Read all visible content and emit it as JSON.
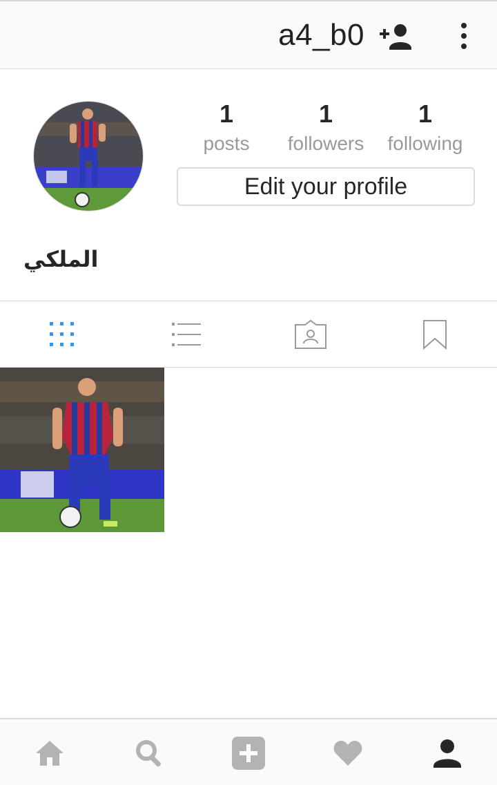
{
  "header": {
    "username": "a4_b0",
    "add_user_icon": "add-person-icon",
    "more_icon": "vertical-dots-icon"
  },
  "profile": {
    "stats": [
      {
        "value": "1",
        "label": "posts"
      },
      {
        "value": "1",
        "label": "followers"
      },
      {
        "value": "1",
        "label": "following"
      }
    ],
    "edit_button_label": "Edit your profile",
    "display_name": "الملكي"
  },
  "tabs": [
    {
      "name": "grid-view",
      "icon": "grid-icon",
      "active": true
    },
    {
      "name": "list-view",
      "icon": "list-icon",
      "active": false
    },
    {
      "name": "tagged",
      "icon": "tagged-photo-icon",
      "active": false
    },
    {
      "name": "saved",
      "icon": "bookmark-icon",
      "active": false
    }
  ],
  "posts": [
    {
      "kind": "photo",
      "subject": "football player in blue and red kit with ball"
    }
  ],
  "bottom_nav": [
    {
      "name": "home",
      "icon": "home-icon",
      "active": false
    },
    {
      "name": "search",
      "icon": "search-icon",
      "active": false
    },
    {
      "name": "new-post",
      "icon": "plus-square-icon",
      "active": false
    },
    {
      "name": "activity",
      "icon": "heart-icon",
      "active": false
    },
    {
      "name": "profile",
      "icon": "person-icon",
      "active": true
    }
  ],
  "colors": {
    "accent": "#3897f0",
    "icon_inactive": "#b3b3b3",
    "icon_active": "#262626",
    "muted_text": "#999999",
    "border": "#dbdbdb"
  }
}
